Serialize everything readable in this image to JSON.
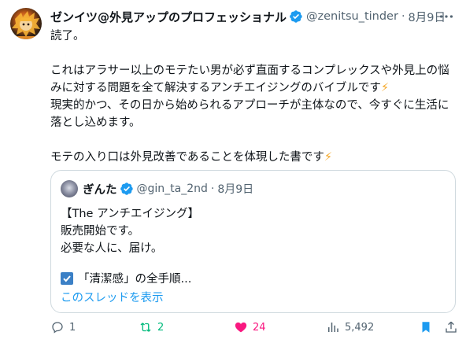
{
  "post": {
    "author_name": "ゼンイツ@外見アップのプロフェッショナル",
    "author_handle": "@zenitsu_tinder",
    "separator": "·",
    "date": "8月9日",
    "line1": "読了。",
    "para1": "これはアラサー以上のモテたい男が必ず直面するコンプレックスや外見上の悩みに対する問題を全て解決するアンチエイジングのバイブルです",
    "para2": "現実的かつ、その日から始められるアプローチが主体なので、今すぐに生活に落とし込めます。",
    "para3": "モテの入り口は外見改善であることを体現した書です",
    "emoji": "⚡"
  },
  "quote": {
    "author_name": "ぎんた",
    "author_handle": "@gin_ta_2nd",
    "separator": "·",
    "date": "8月9日",
    "line1": "【The アンチエイジング】",
    "line2": "販売開始です。",
    "line3": "必要な人に、届け。",
    "checklist_text": "「清潔感」の全手順...",
    "show_thread": "このスレッドを表示"
  },
  "actions": {
    "replies": "1",
    "reposts": "2",
    "likes": "24",
    "views": "5,492"
  },
  "colors": {
    "accent": "#1d9bf0",
    "repost": "#00ba7c",
    "like": "#f91880",
    "bookmark": "#1d9bf0",
    "muted": "#536471"
  },
  "icons": {
    "verified": "verified-badge-icon",
    "more": "more-icon",
    "reply": "reply-icon",
    "repost": "repost-icon",
    "like": "heart-icon",
    "views": "views-icon",
    "bookmark": "bookmark-icon",
    "share": "share-icon"
  }
}
